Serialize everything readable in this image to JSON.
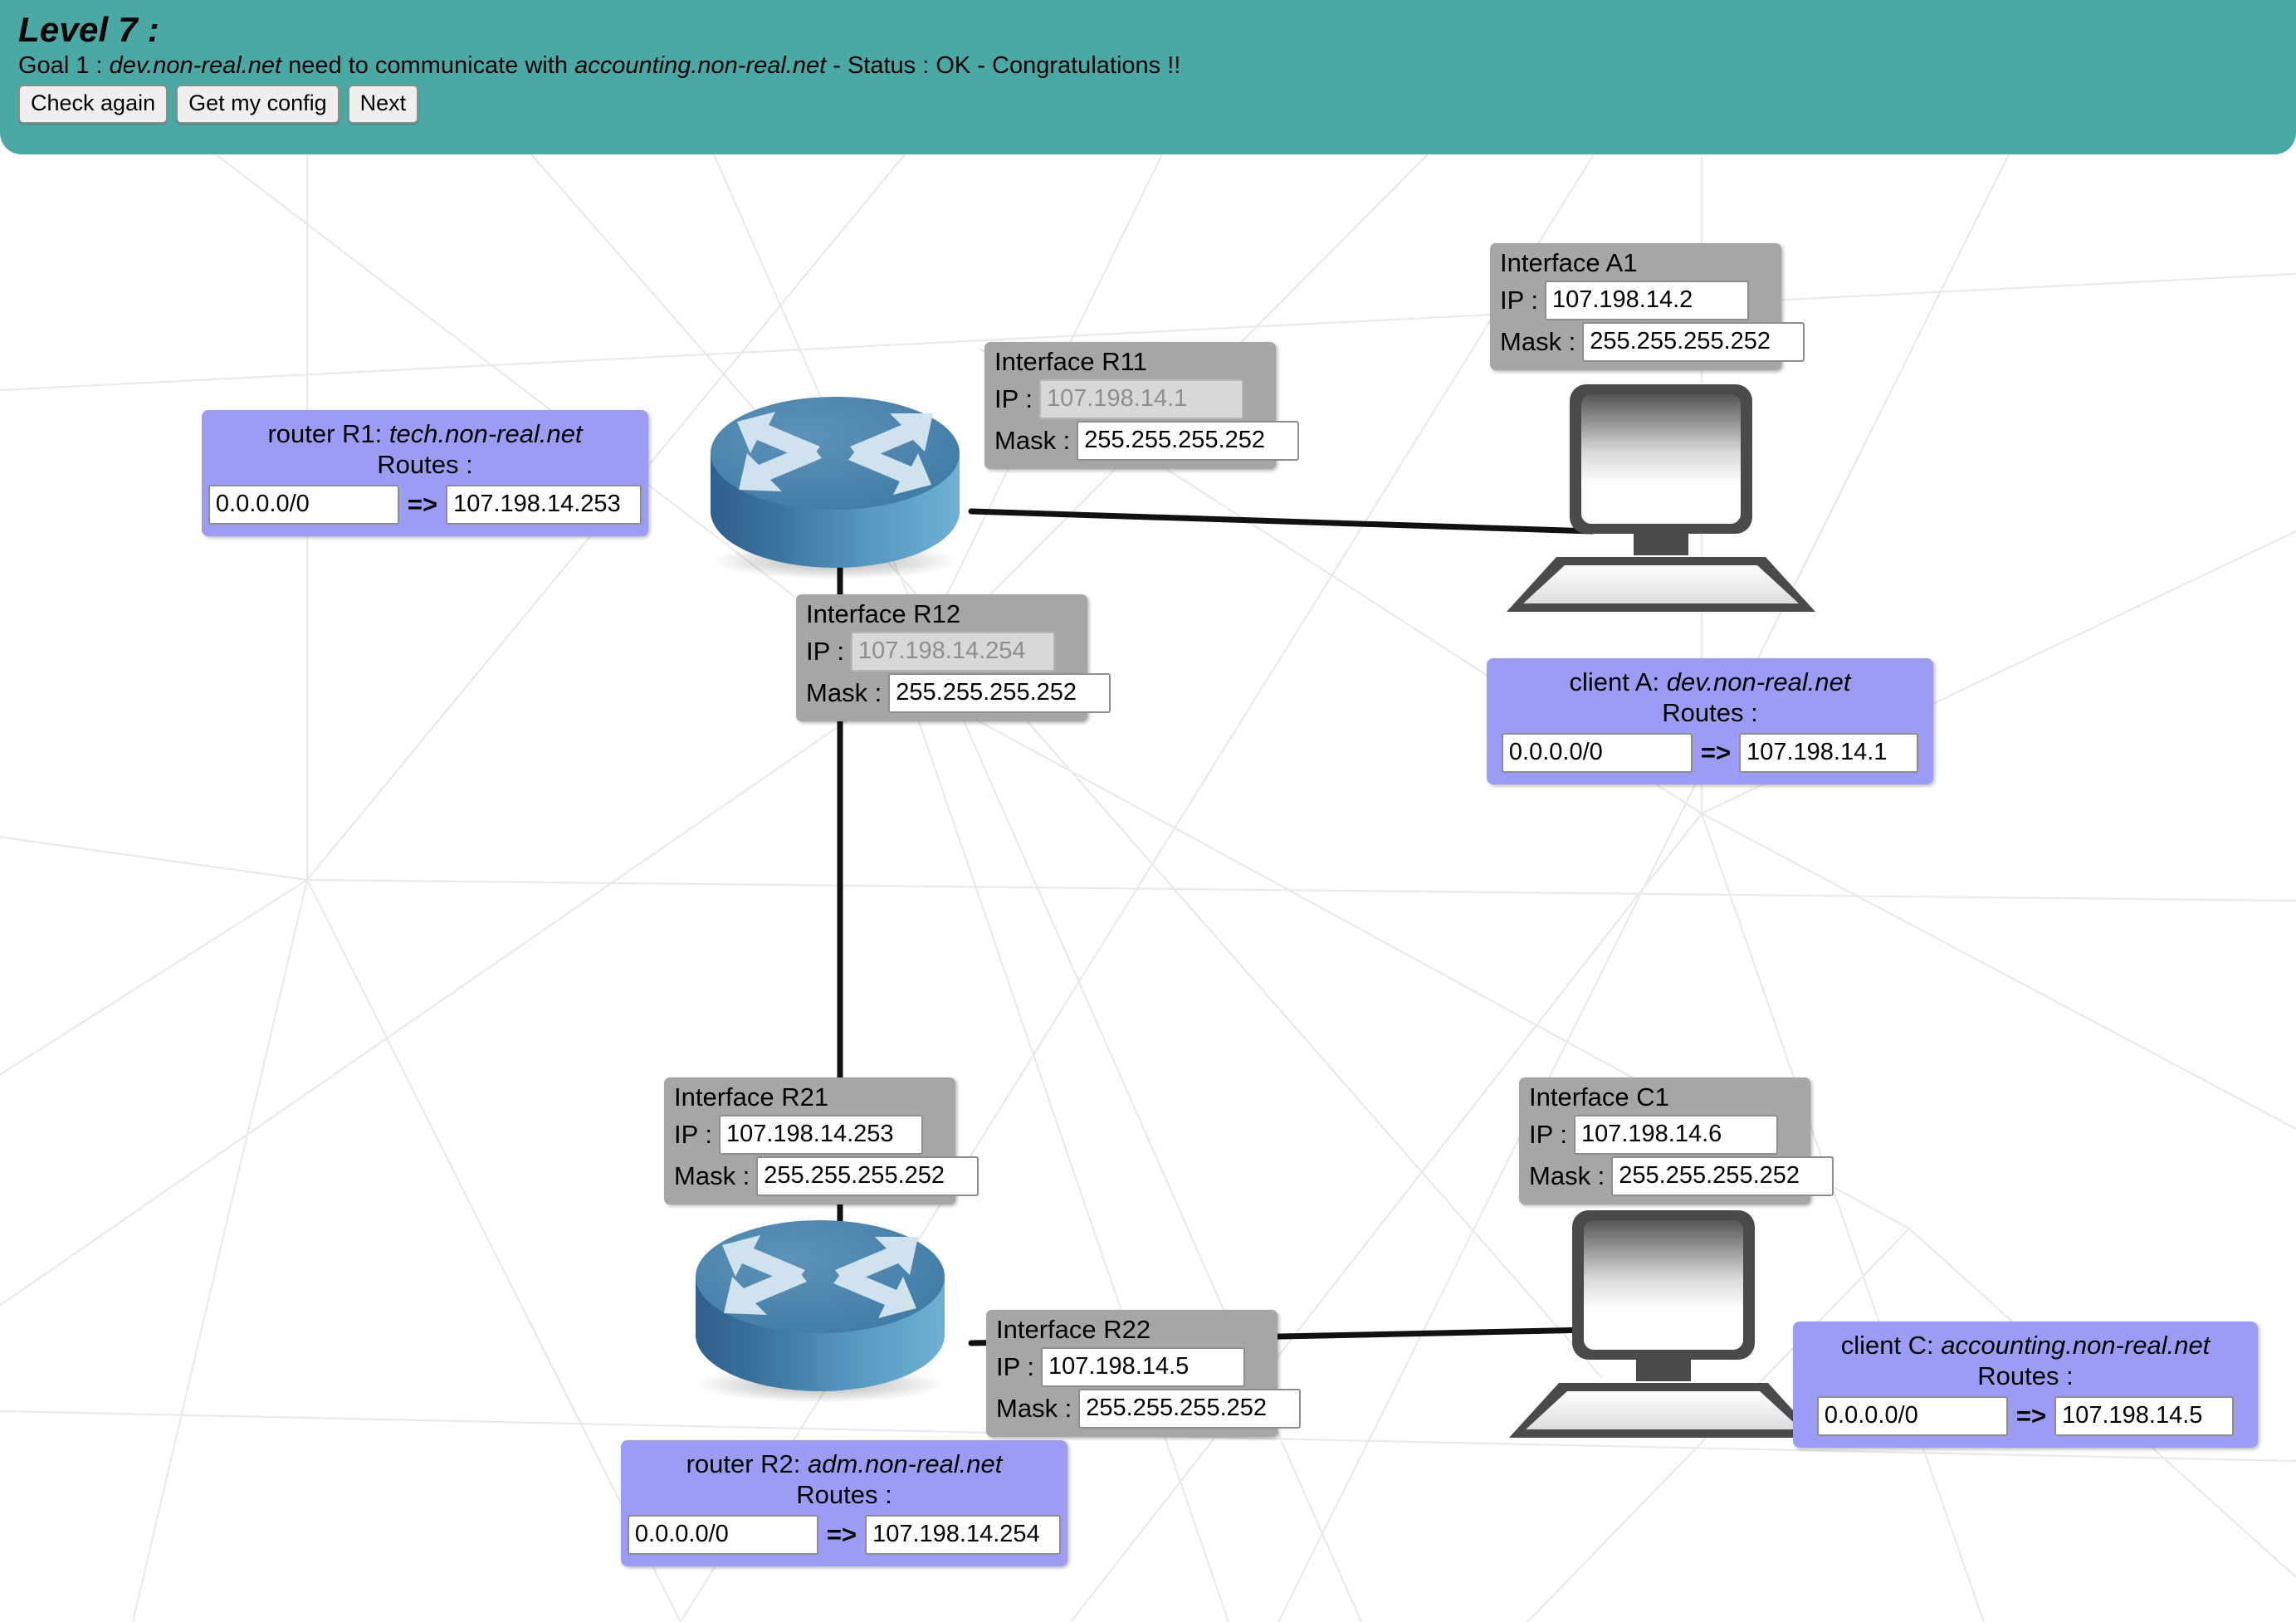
{
  "header": {
    "level_title": "Level 7 :",
    "goal_prefix": "Goal 1 : ",
    "goal_host_a": "dev.non-real.net",
    "goal_middle": " need to communicate with ",
    "goal_host_b": "accounting.non-real.net",
    "goal_suffix": " - Status : OK - Congratulations !!",
    "accent_color": "#4aa8a5",
    "buttons": [
      {
        "label": "Check again",
        "name": "check-again-button"
      },
      {
        "label": "Get my config",
        "name": "get-my-config-button"
      },
      {
        "label": "Next",
        "name": "next-button"
      }
    ]
  },
  "labels": {
    "ip": "IP :",
    "mask": "Mask :",
    "routes": "Routes :",
    "arrow": "=>"
  },
  "colors": {
    "interface_box": "#a6a6a6",
    "route_box": "#9c9cf5",
    "router_body": "#4b84ad",
    "link": "#000000"
  },
  "interfaces": [
    {
      "id": "R11",
      "title": "Interface R11",
      "ip": "107.198.14.1",
      "ip_disabled": true,
      "mask": "255.255.255.252"
    },
    {
      "id": "A1",
      "title": "Interface A1",
      "ip": "107.198.14.2",
      "ip_disabled": false,
      "mask": "255.255.255.252"
    },
    {
      "id": "R12",
      "title": "Interface R12",
      "ip": "107.198.14.254",
      "ip_disabled": true,
      "mask": "255.255.255.252"
    },
    {
      "id": "R21",
      "title": "Interface R21",
      "ip": "107.198.14.253",
      "ip_disabled": false,
      "mask": "255.255.255.252"
    },
    {
      "id": "C1",
      "title": "Interface C1",
      "ip": "107.198.14.6",
      "ip_disabled": false,
      "mask": "255.255.255.252"
    },
    {
      "id": "R22",
      "title": "Interface R22",
      "ip": "107.198.14.5",
      "ip_disabled": false,
      "mask": "255.255.255.252"
    }
  ],
  "nodes": {
    "router_r1": {
      "kind": "router",
      "box_title_prefix": "router R1: ",
      "box_title_host": "tech.non-real.net",
      "routes_label": "Routes :",
      "route_dest": "0.0.0.0/0",
      "route_gateway": "107.198.14.253"
    },
    "client_a": {
      "kind": "client",
      "box_title_prefix": "client A: ",
      "box_title_host": "dev.non-real.net",
      "routes_label": "Routes :",
      "route_dest": "0.0.0.0/0",
      "route_gateway": "107.198.14.1"
    },
    "router_r2": {
      "kind": "router",
      "box_title_prefix": "router R2: ",
      "box_title_host": "adm.non-real.net",
      "routes_label": "Routes :",
      "route_dest": "0.0.0.0/0",
      "route_gateway": "107.198.14.254"
    },
    "client_c": {
      "kind": "client",
      "box_title_prefix": "client C: ",
      "box_title_host": "accounting.non-real.net",
      "routes_label": "Routes :",
      "route_dest": "0.0.0.0/0",
      "route_gateway": "107.198.14.5"
    }
  },
  "icons": {
    "router": "router-icon",
    "client": "desktop-computer-icon"
  }
}
